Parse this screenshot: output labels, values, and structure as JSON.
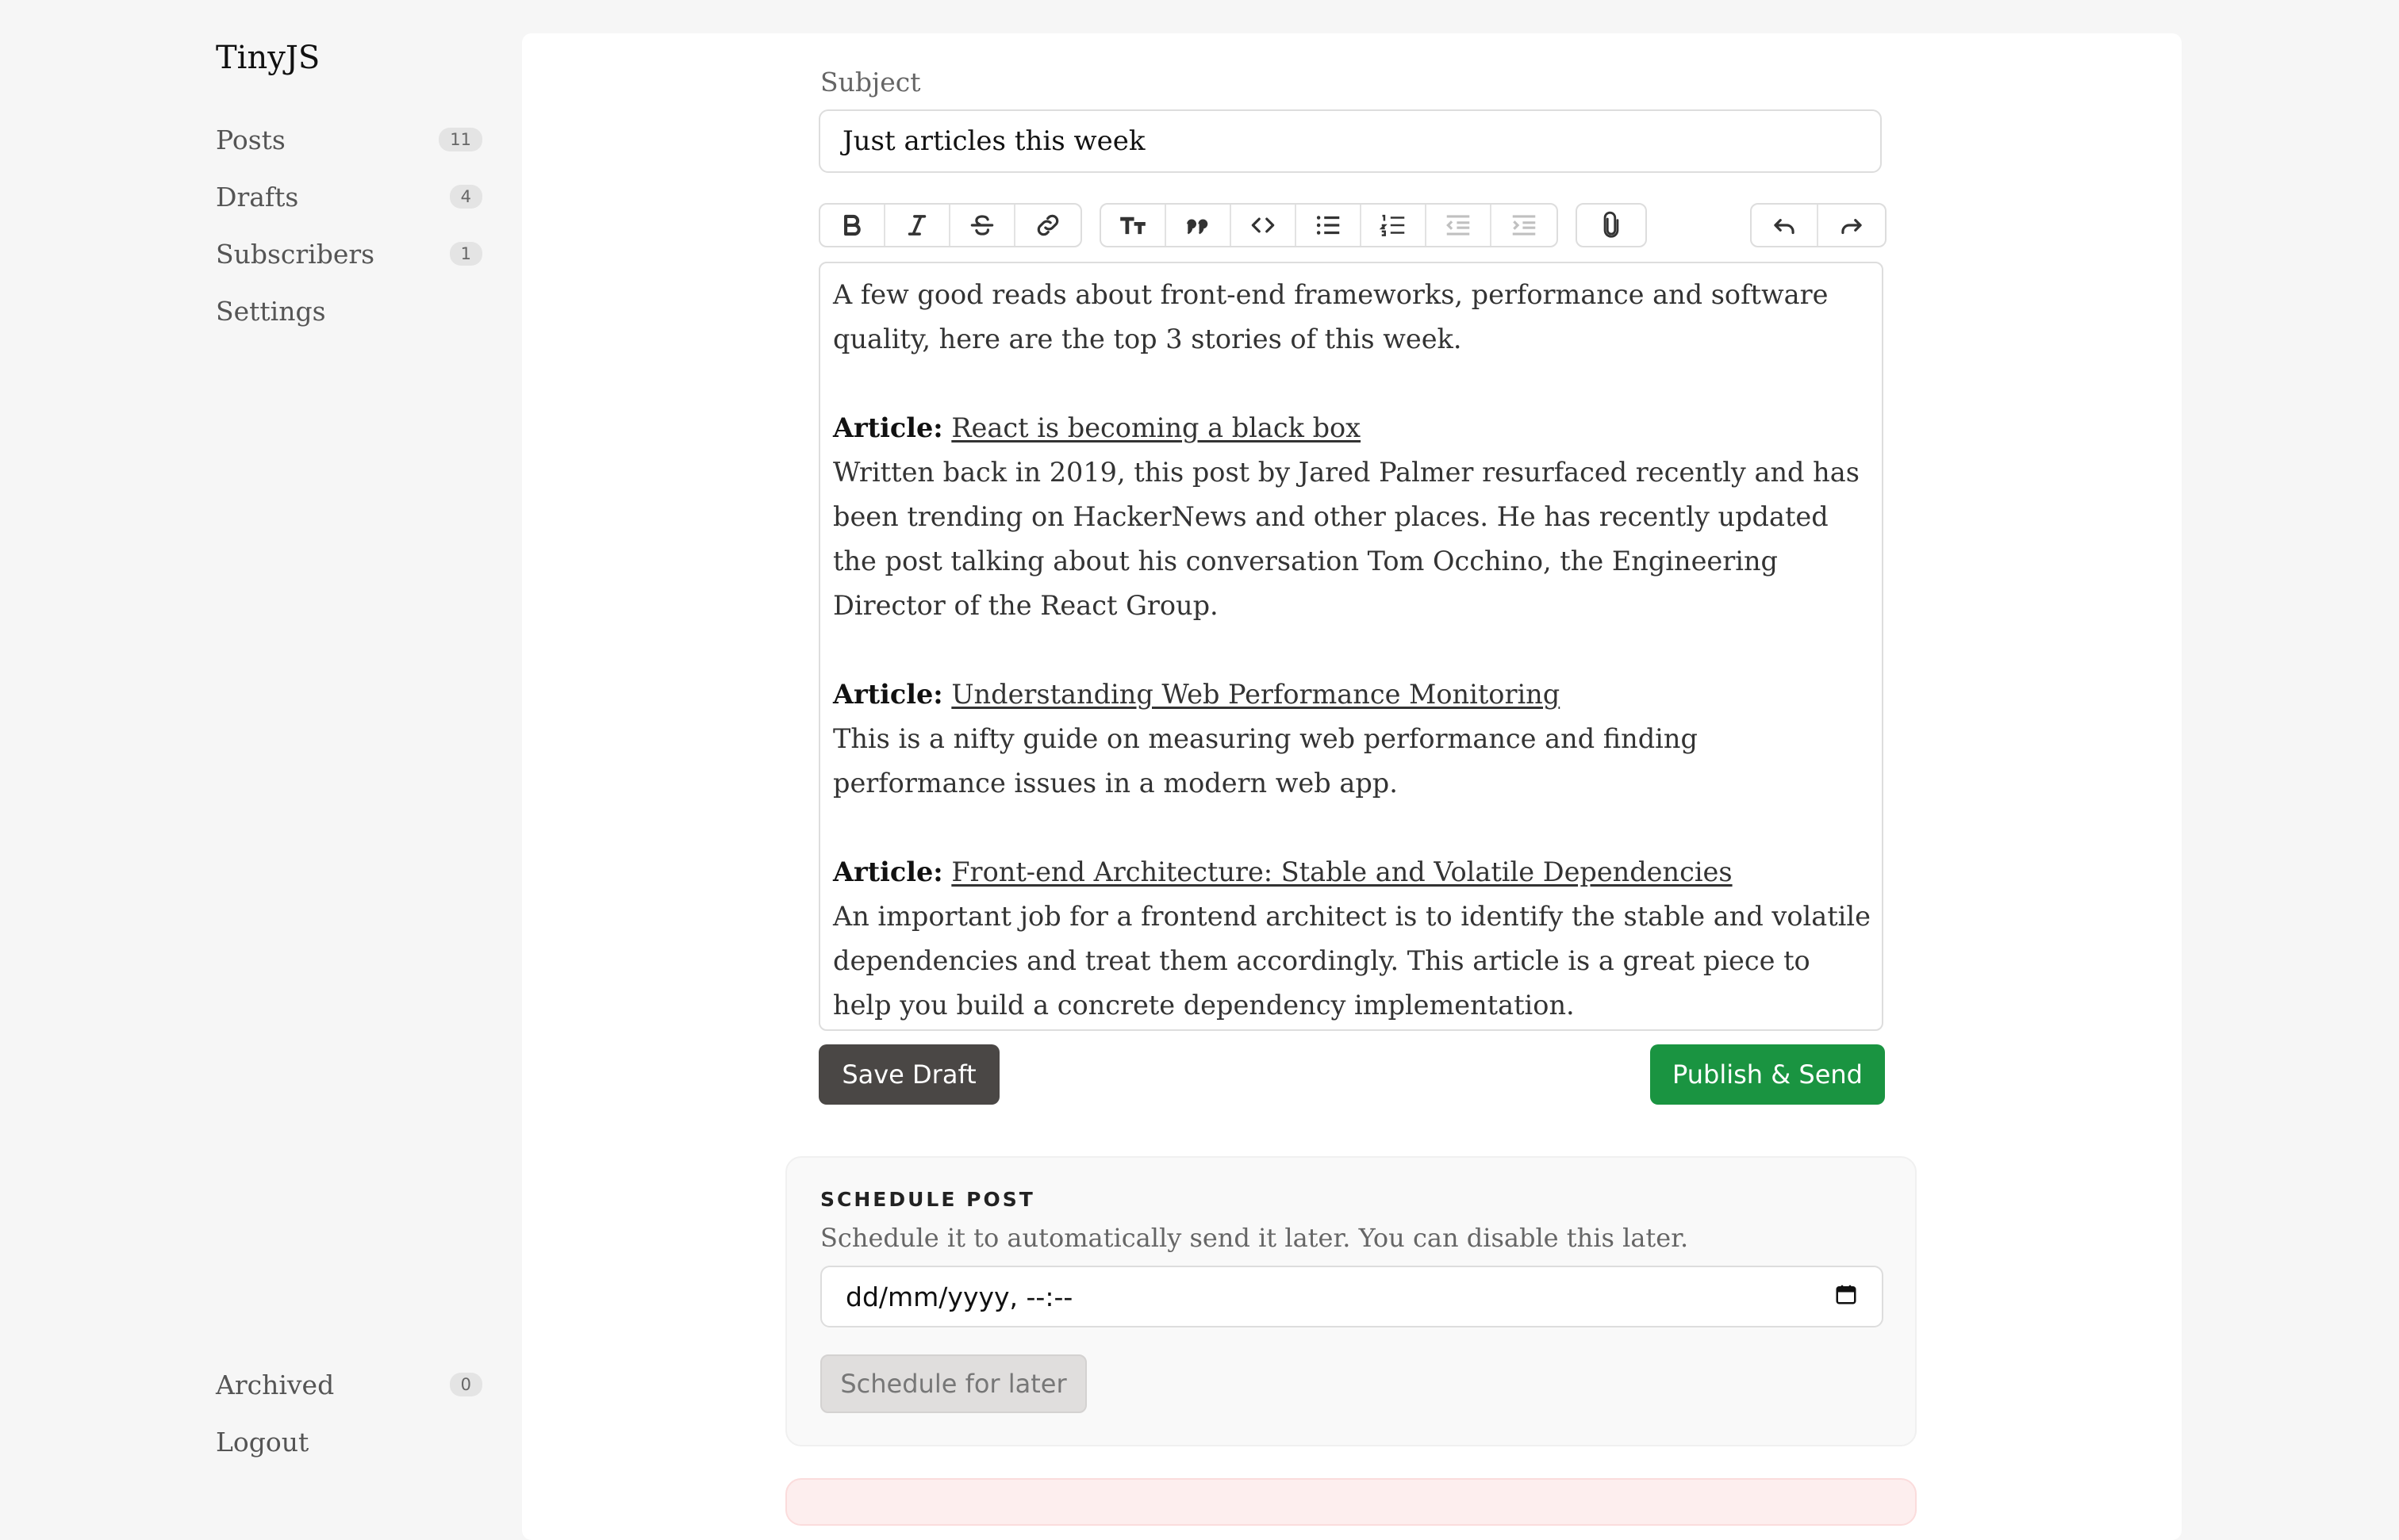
{
  "app": {
    "brand": "TinyJS"
  },
  "sidebar": {
    "items": [
      {
        "label": "Posts",
        "count": "11"
      },
      {
        "label": "Drafts",
        "count": "4"
      },
      {
        "label": "Subscribers",
        "count": "1"
      },
      {
        "label": "Settings"
      }
    ],
    "bottom_items": [
      {
        "label": "Archived",
        "count": "0"
      },
      {
        "label": "Logout"
      }
    ]
  },
  "editor": {
    "subject_label": "Subject",
    "subject_value": "Just articles this week",
    "toolbar": {
      "groups": [
        [
          "bold-icon",
          "italic-icon",
          "strikethrough-icon",
          "link-icon"
        ],
        [
          "heading-icon",
          "quote-icon",
          "code-icon",
          "bullet-list-icon",
          "numbered-list-icon",
          "outdent-icon",
          "indent-icon"
        ],
        [
          "attachment-icon"
        ],
        [
          "undo-icon",
          "redo-icon"
        ]
      ]
    },
    "body": {
      "intro": "A few good reads about front-end frameworks, performance and software quality, here are the top 3 stories of this week.",
      "article_prefix": "Article:",
      "articles": [
        {
          "title": "React is becoming a black box",
          "text": "Written back in 2019, this post by Jared Palmer resurfaced recently and has been trending on HackerNews and other places. He has recently updated the post talking about his conversation Tom Occhino, the Engineering Director of the React Group."
        },
        {
          "title": "Understanding Web Performance Monitoring",
          "text": "This is a nifty guide on measuring web performance and finding performance issues in a modern web app."
        },
        {
          "title": "Front-end Architecture: Stable and Volatile Dependencies",
          "text": "An important job for a frontend architect is to identify the stable and volatile dependencies and treat them accordingly. This article is a great piece to help you build a concrete dependency implementation."
        }
      ]
    },
    "save_draft_label": "Save Draft",
    "publish_label": "Publish & Send"
  },
  "schedule": {
    "title": "SCHEDULE POST",
    "description": "Schedule it to automatically send it later. You can disable this later.",
    "datetime_placeholder": "dd/mm/yyyy, --:--",
    "button_label": "Schedule for later"
  },
  "colors": {
    "publish": "#1a9441",
    "draft": "#4a4745",
    "background": "#f6f6f6"
  }
}
